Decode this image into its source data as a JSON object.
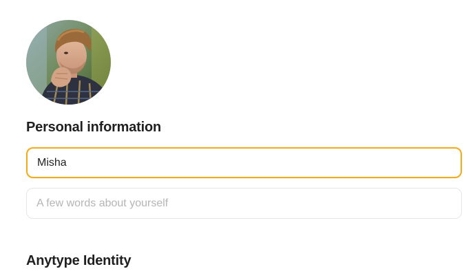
{
  "profile": {
    "avatar_icon": "user-photo"
  },
  "personal": {
    "title": "Personal information",
    "name_value": "Misha",
    "name_placeholder": "",
    "description_value": "",
    "description_placeholder": "A few words about yourself"
  },
  "identity": {
    "title": "Anytype Identity"
  },
  "colors": {
    "focus_border": "#f0ac1e",
    "field_border": "#e6e6e6",
    "placeholder": "#b5b5b5",
    "text": "#1f1f1f"
  }
}
